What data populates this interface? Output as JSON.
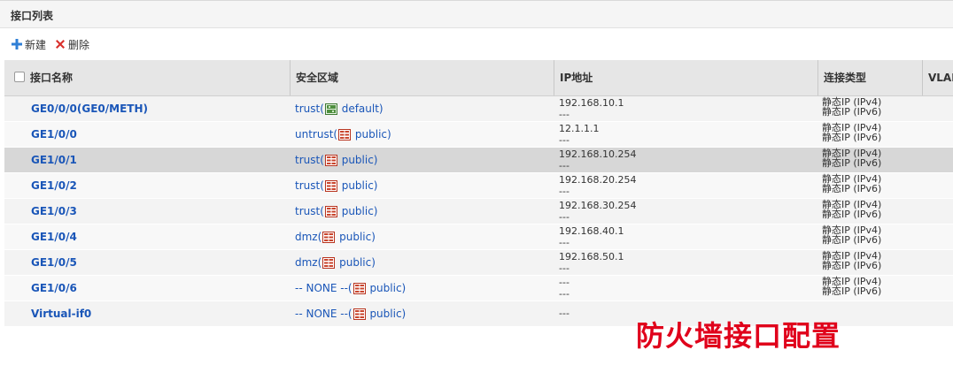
{
  "panel": {
    "title": "接口列表"
  },
  "toolbar": {
    "new_label": "新建",
    "delete_label": "删除"
  },
  "table": {
    "headers": [
      "接口名称",
      "安全区域",
      "IP地址",
      "连接类型",
      "VLAN"
    ],
    "rows": [
      {
        "name": "GE0/0/0(GE0/METH)",
        "zone": "trust(",
        "vsys": " default)",
        "zone_icon": "vsys-default-icon",
        "ip1": "192.168.10.1",
        "ip2": "---",
        "conn1": "静态IP (IPv4)",
        "conn2": "静态IP (IPv6)"
      },
      {
        "name": "GE1/0/0",
        "zone": "untrust(",
        "vsys": " public)",
        "zone_icon": "vsys-public-icon",
        "ip1": "12.1.1.1",
        "ip2": "---",
        "conn1": "静态IP (IPv4)",
        "conn2": "静态IP (IPv6)"
      },
      {
        "name": "GE1/0/1",
        "zone": "trust(",
        "vsys": " public)",
        "zone_icon": "vsys-public-icon",
        "ip1": "192.168.10.254",
        "ip2": "---",
        "conn1": "静态IP (IPv4)",
        "conn2": "静态IP (IPv6)"
      },
      {
        "name": "GE1/0/2",
        "zone": "trust(",
        "vsys": " public)",
        "zone_icon": "vsys-public-icon",
        "ip1": "192.168.20.254",
        "ip2": "---",
        "conn1": "静态IP (IPv4)",
        "conn2": "静态IP (IPv6)"
      },
      {
        "name": "GE1/0/3",
        "zone": "trust(",
        "vsys": " public)",
        "zone_icon": "vsys-public-icon",
        "ip1": "192.168.30.254",
        "ip2": "---",
        "conn1": "静态IP (IPv4)",
        "conn2": "静态IP (IPv6)"
      },
      {
        "name": "GE1/0/4",
        "zone": "dmz(",
        "vsys": " public)",
        "zone_icon": "vsys-public-icon",
        "ip1": "192.168.40.1",
        "ip2": "---",
        "conn1": "静态IP (IPv4)",
        "conn2": "静态IP (IPv6)"
      },
      {
        "name": "GE1/0/5",
        "zone": "dmz(",
        "vsys": " public)",
        "zone_icon": "vsys-public-icon",
        "ip1": "192.168.50.1",
        "ip2": "---",
        "conn1": "静态IP (IPv4)",
        "conn2": "静态IP (IPv6)"
      },
      {
        "name": "GE1/0/6",
        "zone": "-- NONE --(",
        "vsys": " public)",
        "zone_icon": "vsys-public-icon",
        "ip1": "---",
        "ip2": "---",
        "conn1": "静态IP (IPv4)",
        "conn2": "静态IP (IPv6)"
      },
      {
        "name": "Virtual-if0",
        "zone": "-- NONE --(",
        "vsys": " public)",
        "zone_icon": "vsys-public-icon",
        "ip1": "---",
        "ip2": "",
        "conn1": "",
        "conn2": ""
      }
    ]
  },
  "watermark": "防火墙接口配置",
  "colors": {
    "link": "#1a56b8",
    "watermark": "#e0001b",
    "selected_row": "#d7d7d7",
    "header_bg": "#e6e6e6"
  }
}
